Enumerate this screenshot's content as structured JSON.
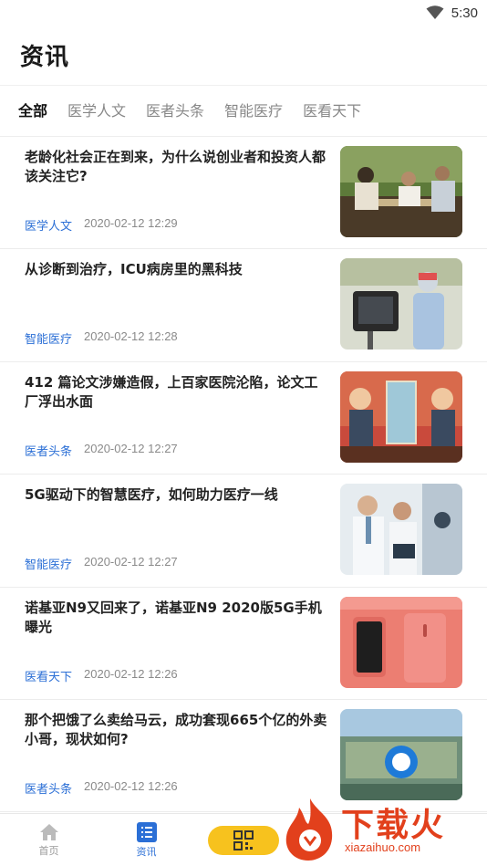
{
  "status_bar": {
    "time": "5:30",
    "wifi_icon": "wifi-icon"
  },
  "header": {
    "title": "资讯"
  },
  "tabs": [
    {
      "label": "全部",
      "active": true
    },
    {
      "label": "医学人文",
      "active": false
    },
    {
      "label": "医者头条",
      "active": false
    },
    {
      "label": "智能医疗",
      "active": false
    },
    {
      "label": "医看天下",
      "active": false
    }
  ],
  "articles": [
    {
      "title": "老龄化社会正在到来，为什么说创业者和投资人都该关注它?",
      "category": "医学人文",
      "date": "2020-02-12 12:29",
      "thumb": "elderly-playing-chess-photo"
    },
    {
      "title": "从诊断到治疗，ICU病房里的黑科技",
      "category": "智能医疗",
      "date": "2020-02-12 12:28",
      "thumb": "icu-robot-photo"
    },
    {
      "title": "412 篇论文涉嫌造假，上百家医院沦陷，论文工厂浮出水面",
      "category": "医者头条",
      "date": "2020-02-12 12:27",
      "thumb": "cartoon-mirror-illustration"
    },
    {
      "title": "5G驱动下的智慧医疗，如何助力医疗一线",
      "category": "智能医疗",
      "date": "2020-02-12 12:27",
      "thumb": "doctors-tablet-photo"
    },
    {
      "title": "诺基亚N9又回来了，诺基亚N9 2020版5G手机曝光",
      "category": "医看天下",
      "date": "2020-02-12 12:26",
      "thumb": "pink-phone-photo"
    },
    {
      "title": "那个把饿了么卖给马云，成功套现665个亿的外卖小哥，现状如何?",
      "category": "医者头条",
      "date": "2020-02-12 12:26",
      "thumb": "eleme-building-photo"
    }
  ],
  "bottom_nav": [
    {
      "label": "首页",
      "icon": "home-icon",
      "active": false
    },
    {
      "label": "资讯",
      "icon": "list-icon",
      "active": true
    }
  ],
  "scan_button": {
    "icon": "qr-code-icon"
  },
  "watermark": {
    "text": "下载火",
    "url": "xiazaihuo.com"
  },
  "colors": {
    "accent": "#2b6fd6",
    "scan_button": "#f7c21e",
    "watermark": "#e2401c"
  }
}
